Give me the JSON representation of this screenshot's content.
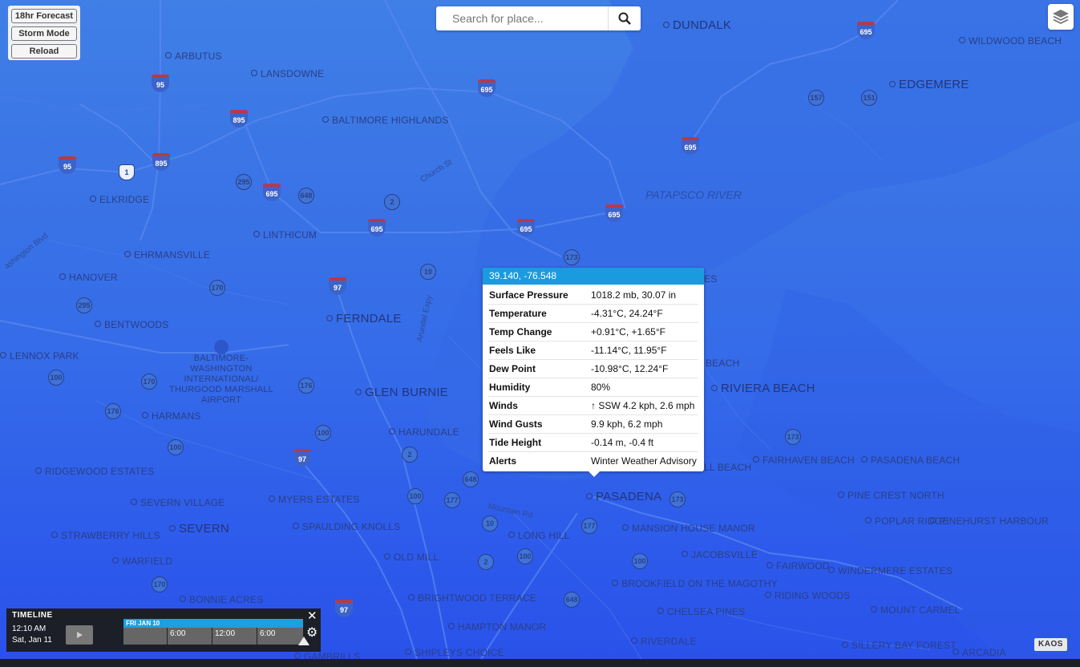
{
  "controls": {
    "forecast_label": "18hr Forecast",
    "storm_label": "Storm Mode",
    "reload_label": "Reload"
  },
  "search": {
    "placeholder": "Search for place..."
  },
  "places": [
    {
      "id": "arbutus",
      "label": "ARBUTUS"
    },
    {
      "id": "lansdowne",
      "label": "LANSDOWNE"
    },
    {
      "id": "baltimore-highlands",
      "label": "BALTIMORE HIGHLANDS"
    },
    {
      "id": "dundalk",
      "label": "DUNDALK"
    },
    {
      "id": "edgemere",
      "label": "EDGEMERE"
    },
    {
      "id": "wildwood-beach",
      "label": "WILDWOOD BEACH"
    },
    {
      "id": "elkridge",
      "label": "ELKRIDGE"
    },
    {
      "id": "linthicum",
      "label": "LINTHICUM"
    },
    {
      "id": "ehrmansville",
      "label": "EHRMANSVILLE"
    },
    {
      "id": "hanover",
      "label": "HANOVER"
    },
    {
      "id": "bentwoods",
      "label": "BENTWOODS"
    },
    {
      "id": "ferndale",
      "label": "FERNDALE"
    },
    {
      "id": "lennox-park",
      "label": "LENNOX PARK"
    },
    {
      "id": "airport",
      "label": "BALTIMORE-WASHINGTON INTERNATIONAL/ THURGOOD MARSHALL AIRPORT"
    },
    {
      "id": "glen-burnie",
      "label": "GLEN BURNIE"
    },
    {
      "id": "harmans",
      "label": "HARMANS"
    },
    {
      "id": "harundale",
      "label": "HARUNDALE"
    },
    {
      "id": "riviera-beach",
      "label": "RIVIERA BEACH"
    },
    {
      "id": "ridgewood",
      "label": "RIDGEWOOD ESTATES"
    },
    {
      "id": "fairhaven",
      "label": "FAIRHAVEN BEACH"
    },
    {
      "id": "pasadena-beach",
      "label": "PASADENA BEACH"
    },
    {
      "id": "severn-village",
      "label": "SEVERN VILLAGE"
    },
    {
      "id": "myers",
      "label": "MYERS ESTATES"
    },
    {
      "id": "pasadena",
      "label": "PASADENA"
    },
    {
      "id": "pine-crest",
      "label": "PINE CREST NORTH"
    },
    {
      "id": "severn",
      "label": "SEVERN"
    },
    {
      "id": "spaulding",
      "label": "SPAULDING KNOLLS"
    },
    {
      "id": "mansion",
      "label": "MANSION HOUSE MANOR"
    },
    {
      "id": "poplar",
      "label": "POPLAR RIDGE"
    },
    {
      "id": "pinehurst",
      "label": "PINEHURST HARBOUR"
    },
    {
      "id": "strawberry",
      "label": "STRAWBERRY HILLS"
    },
    {
      "id": "long-hill",
      "label": "LONG HILL"
    },
    {
      "id": "jacobsville",
      "label": "JACOBSVILLE"
    },
    {
      "id": "warfield",
      "label": "WARFIELD"
    },
    {
      "id": "old-mill",
      "label": "OLD MILL"
    },
    {
      "id": "fairwood",
      "label": "FAIRWOOD"
    },
    {
      "id": "windermere",
      "label": "WINDERMERE ESTATES"
    },
    {
      "id": "brookfield",
      "label": "BROOKFIELD ON THE MAGOTHY"
    },
    {
      "id": "bonnie",
      "label": "BONNIE ACRES"
    },
    {
      "id": "brightwood",
      "label": "BRIGHTWOOD TERRACE"
    },
    {
      "id": "riding-woods",
      "label": "RIDING WOODS"
    },
    {
      "id": "chelsea",
      "label": "CHELSEA PINES"
    },
    {
      "id": "mount-carmel",
      "label": "MOUNT CARMEL"
    },
    {
      "id": "hampton",
      "label": "HAMPTON MANOR"
    },
    {
      "id": "riverdale",
      "label": "RIVERDALE"
    },
    {
      "id": "shipleys",
      "label": "SHIPLEYS CHOICE"
    },
    {
      "id": "sillery",
      "label": "SILLERY BAY FOREST"
    },
    {
      "id": "arcadia",
      "label": "ARCADIA"
    },
    {
      "id": "gambrills",
      "label": "GAMBRILLS"
    },
    {
      "id": "es-partial",
      "label": "ES"
    },
    {
      "id": "beach-partial-1",
      "label": "BEACH"
    },
    {
      "id": "beach-partial-2",
      "label": "LL BEACH"
    }
  ],
  "water": [
    {
      "id": "patapsco",
      "label": "PATAPSCO RIVER"
    }
  ],
  "streets": [
    {
      "id": "church",
      "label": "Church St"
    },
    {
      "id": "arundel",
      "label": "Arundel Expy"
    },
    {
      "id": "mountain",
      "label": "Mountain Rd"
    },
    {
      "id": "washington",
      "label": "ashington Blvd"
    }
  ],
  "shields": [
    {
      "id": "i695-a",
      "label": "695",
      "kind": "i"
    },
    {
      "id": "i695-b",
      "label": "695",
      "kind": "i"
    },
    {
      "id": "i95-a",
      "label": "95",
      "kind": "i"
    },
    {
      "id": "i895-a",
      "label": "895",
      "kind": "i"
    },
    {
      "id": "i95-b",
      "label": "95",
      "kind": "i"
    },
    {
      "id": "i895-b",
      "label": "895",
      "kind": "i"
    },
    {
      "id": "us1",
      "label": "1",
      "kind": "us"
    },
    {
      "id": "s295-a",
      "label": "295",
      "kind": "s"
    },
    {
      "id": "i695-c",
      "label": "695",
      "kind": "i"
    },
    {
      "id": "s648-a",
      "label": "648",
      "kind": "s"
    },
    {
      "id": "s2-a",
      "label": "2",
      "kind": "s"
    },
    {
      "id": "i695-d",
      "label": "695",
      "kind": "i"
    },
    {
      "id": "i695-e",
      "label": "695",
      "kind": "i"
    },
    {
      "id": "i695-f",
      "label": "695",
      "kind": "i"
    },
    {
      "id": "i695-g",
      "label": "695",
      "kind": "i"
    },
    {
      "id": "s157",
      "label": "157",
      "kind": "s"
    },
    {
      "id": "s151",
      "label": "151",
      "kind": "s"
    },
    {
      "id": "s173-a",
      "label": "173",
      "kind": "s"
    },
    {
      "id": "s10-a",
      "label": "10",
      "kind": "s"
    },
    {
      "id": "s170-a",
      "label": "170",
      "kind": "s"
    },
    {
      "id": "i97-a",
      "label": "97",
      "kind": "i"
    },
    {
      "id": "s295-b",
      "label": "295",
      "kind": "s"
    },
    {
      "id": "s100-a",
      "label": "100",
      "kind": "s"
    },
    {
      "id": "s170-b",
      "label": "170",
      "kind": "s"
    },
    {
      "id": "s176-a",
      "label": "176",
      "kind": "s"
    },
    {
      "id": "s176-b",
      "label": "176",
      "kind": "s"
    },
    {
      "id": "s100-b",
      "label": "100",
      "kind": "s"
    },
    {
      "id": "s100-c",
      "label": "100",
      "kind": "s"
    },
    {
      "id": "i97-b",
      "label": "97",
      "kind": "i"
    },
    {
      "id": "s2-b",
      "label": "2",
      "kind": "s"
    },
    {
      "id": "s648-b",
      "label": "648",
      "kind": "s"
    },
    {
      "id": "s100-d",
      "label": "100",
      "kind": "s"
    },
    {
      "id": "s177-a",
      "label": "177",
      "kind": "s"
    },
    {
      "id": "s173-b",
      "label": "173",
      "kind": "s"
    },
    {
      "id": "s173-c",
      "label": "173",
      "kind": "s"
    },
    {
      "id": "s10-b",
      "label": "10",
      "kind": "s"
    },
    {
      "id": "s177-b",
      "label": "177",
      "kind": "s"
    },
    {
      "id": "s100-e",
      "label": "100",
      "kind": "s"
    },
    {
      "id": "s2-c",
      "label": "2",
      "kind": "s"
    },
    {
      "id": "s100-f",
      "label": "100",
      "kind": "s"
    },
    {
      "id": "s170-c",
      "label": "170",
      "kind": "s"
    },
    {
      "id": "i97-c",
      "label": "97",
      "kind": "i"
    },
    {
      "id": "s648-c",
      "label": "648",
      "kind": "s"
    }
  ],
  "popup": {
    "coords": "39.140, -76.548",
    "rows": [
      {
        "label": "Surface Pressure",
        "value": "1018.2 mb, 30.07 in"
      },
      {
        "label": "Temperature",
        "value": "-4.31°C, 24.24°F"
      },
      {
        "label": "Temp Change",
        "value": "+0.91°C, +1.65°F"
      },
      {
        "label": "Feels Like",
        "value": "-11.14°C, 11.95°F"
      },
      {
        "label": "Dew Point",
        "value": "-10.98°C, 12.24°F"
      },
      {
        "label": "Humidity",
        "value": "80%"
      },
      {
        "label": "Winds",
        "value": "↑ SSW 4.2 kph, 2.6 mph"
      },
      {
        "label": "Wind Gusts",
        "value": "9.9 kph, 6.2 mph"
      },
      {
        "label": "Tide Height",
        "value": "-0.14 m, -0.4 ft"
      },
      {
        "label": "Alerts",
        "value": "Winter Weather Advisory"
      }
    ]
  },
  "timeline": {
    "title": "TIMELINE",
    "time": "12:10 AM",
    "date": "Sat, Jan 11",
    "day_label": "FRI JAN 10",
    "ticks": [
      "6:00",
      "12:00",
      "6:00"
    ]
  },
  "attribution": "KAOS",
  "colors": {
    "accent": "#1a9be0",
    "map_blue": "#3a73e6",
    "timeline_bg": "#1c1f27"
  }
}
